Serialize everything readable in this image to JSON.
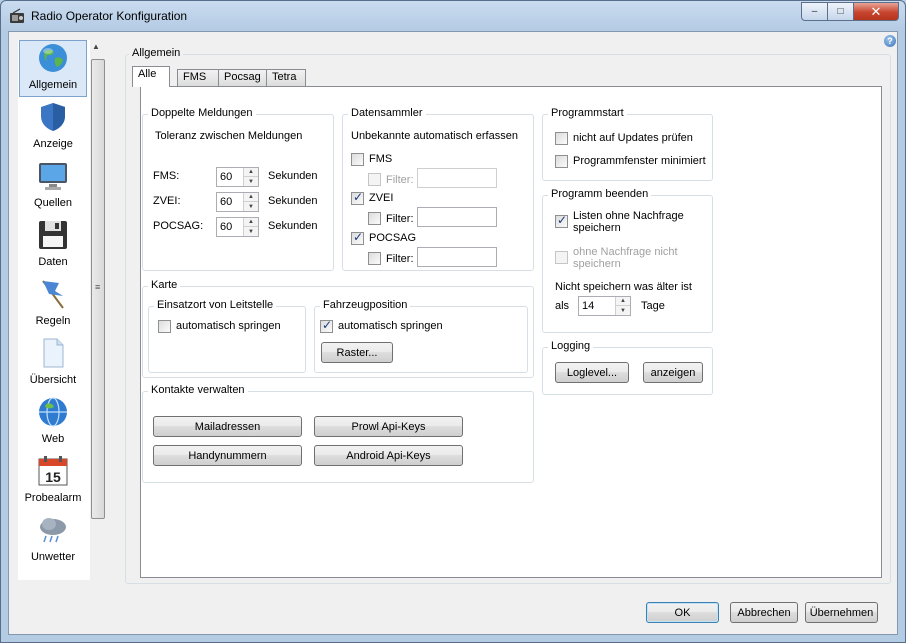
{
  "window": {
    "title": "Radio Operator Konfiguration"
  },
  "caption": {
    "minimize": "–",
    "maximize": "□",
    "close": "✕"
  },
  "help": "?",
  "sidebar": {
    "items": [
      {
        "label": "Allgemein",
        "icon": "globe-icon",
        "selected": true
      },
      {
        "label": "Anzeige",
        "icon": "shield-icon"
      },
      {
        "label": "Quellen",
        "icon": "monitor-icon"
      },
      {
        "label": "Daten",
        "icon": "floppy-icon"
      },
      {
        "label": "Regeln",
        "icon": "flag-icon"
      },
      {
        "label": "Übersicht",
        "icon": "document-icon"
      },
      {
        "label": "Web",
        "icon": "web-globe-icon"
      },
      {
        "label": "Probealarm",
        "icon": "calendar-icon",
        "icon_text": "15"
      },
      {
        "label": "Unwetter",
        "icon": "storm-cloud-icon"
      }
    ]
  },
  "section_title": "Allgemein",
  "tabs": [
    "Alle",
    "FMS",
    "Pocsag",
    "Tetra"
  ],
  "doppelte": {
    "title": "Doppelte Meldungen",
    "subtitle": "Toleranz zwischen Meldungen",
    "rows": [
      {
        "label": "FMS:",
        "value": "60",
        "unit": "Sekunden"
      },
      {
        "label": "ZVEI:",
        "value": "60",
        "unit": "Sekunden"
      },
      {
        "label": "POCSAG:",
        "value": "60",
        "unit": "Sekunden"
      }
    ]
  },
  "datensammler": {
    "title": "Datensammler",
    "subtitle": "Unbekannte automatisch erfassen",
    "filter_label": "Filter:",
    "items": [
      {
        "label": "FMS",
        "checked": false
      },
      {
        "label": "ZVEI",
        "checked": true
      },
      {
        "label": "POCSAG",
        "checked": true
      }
    ]
  },
  "programmstart": {
    "title": "Programmstart",
    "items": [
      {
        "label": "nicht auf Updates prüfen",
        "checked": false
      },
      {
        "label": "Programmfenster minimiert",
        "checked": false
      }
    ]
  },
  "programm_beenden": {
    "title": "Programm beenden",
    "save_label_1": "Listen ohne Nachfrage",
    "save_label_2": "speichern",
    "save_checked": true,
    "ask_label_1": "ohne Nachfrage nicht",
    "ask_label_2": "speichern",
    "older_label": "Nicht speichern was älter ist",
    "als": "als",
    "days_value": "14",
    "days_unit": "Tage"
  },
  "logging": {
    "title": "Logging",
    "loglevel": "Loglevel...",
    "anzeigen": "anzeigen"
  },
  "karte": {
    "title": "Karte",
    "einsatzort": {
      "title": "Einsatzort von Leitstelle",
      "label": "automatisch springen",
      "checked": false
    },
    "fahrzeug": {
      "title": "Fahrzeugposition",
      "label": "automatisch springen",
      "checked": true,
      "raster": "Raster..."
    }
  },
  "kontakte": {
    "title": "Kontakte verwalten",
    "buttons": [
      "Mailadressen",
      "Prowl Api-Keys",
      "Handynummern",
      "Android Api-Keys"
    ]
  },
  "footer": {
    "ok": "OK",
    "cancel": "Abbrechen",
    "apply": "Übernehmen"
  }
}
